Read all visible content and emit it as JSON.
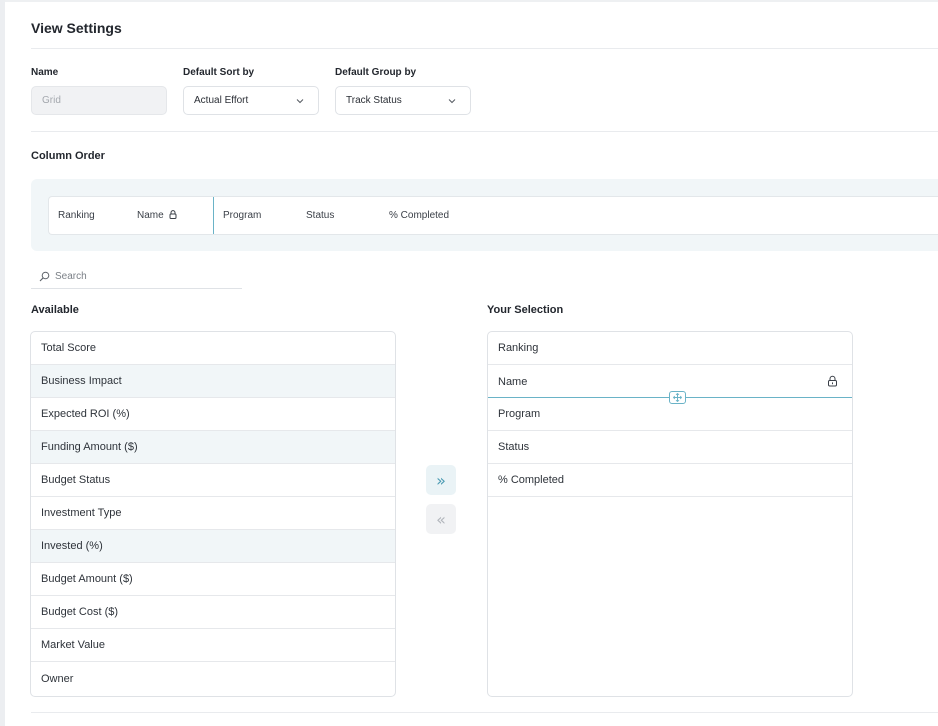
{
  "page": {
    "title": "View Settings"
  },
  "fields": {
    "name": {
      "label": "Name",
      "value": "Grid"
    },
    "sort": {
      "label": "Default Sort by",
      "value": "Actual Effort"
    },
    "group": {
      "label": "Default Group by",
      "value": "Track Status"
    }
  },
  "column_order": {
    "title": "Column Order",
    "items": [
      "Ranking",
      "Name",
      "Program",
      "Status",
      "% Completed"
    ]
  },
  "search": {
    "placeholder": "Search"
  },
  "available": {
    "label": "Available",
    "items": [
      "Total Score",
      "Business Impact",
      "Expected ROI (%)",
      "Funding Amount ($)",
      "Budget Status",
      "Investment Type",
      "Invested (%)",
      "Budget Amount ($)",
      "Budget Cost ($)",
      "Market Value",
      "Owner"
    ]
  },
  "selection": {
    "label": "Your Selection",
    "items": [
      "Ranking",
      "Name",
      "Program",
      "Status",
      "% Completed"
    ]
  },
  "buttons": {
    "add_all": "»",
    "remove_all": "«"
  },
  "icons": {
    "lock": "lock-icon",
    "drag": "drag-handle-icon",
    "chevron": "chevron-down-icon",
    "search": "search-icon"
  },
  "colors": {
    "accent": "#4c9bb3",
    "highlight_row": "#f1f6f8"
  }
}
